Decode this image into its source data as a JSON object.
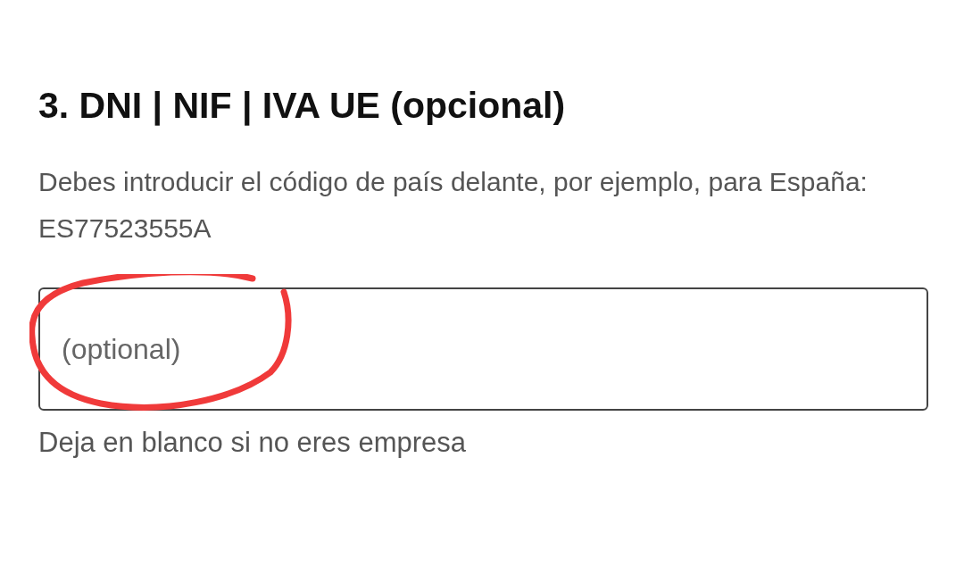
{
  "section": {
    "title": "3. DNI | NIF | IVA UE (opcional)",
    "description": "Debes introducir el código de país delante, por ejemplo, para España: ES77523555A"
  },
  "field": {
    "placeholder": "(optional)",
    "helper": "Deja en blanco si no eres empresa"
  }
}
